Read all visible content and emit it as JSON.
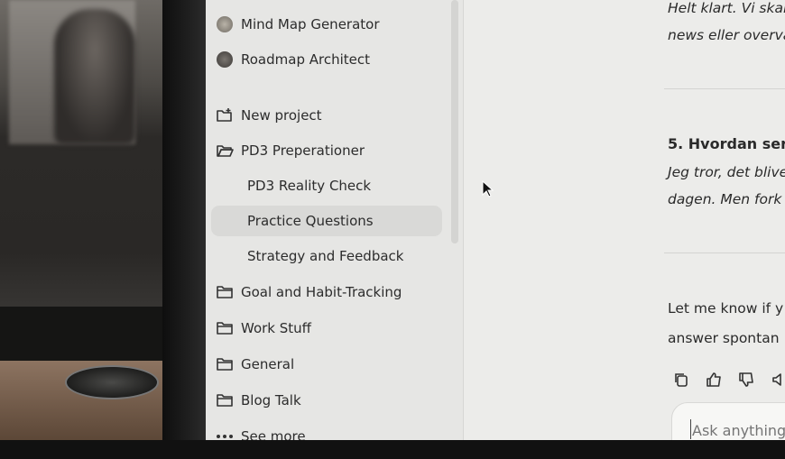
{
  "sidebar": {
    "gpts": [
      {
        "label": "Mind Map Generator",
        "icon": "mind-map-gpt-icon"
      },
      {
        "label": "Roadmap Architect",
        "icon": "roadmap-gpt-icon"
      }
    ],
    "new_project": {
      "label": "New project",
      "icon": "new-folder-icon"
    },
    "projects": [
      {
        "label": "PD3 Preperationer",
        "icon": "folder-open-icon"
      },
      {
        "label": "PD3 Reality Check",
        "icon": ""
      },
      {
        "label": "Practice Questions",
        "icon": ""
      },
      {
        "label": "Strategy and Feedback",
        "icon": ""
      },
      {
        "label": "Goal and Habit-Tracking",
        "icon": "folder-icon"
      },
      {
        "label": "Work Stuff",
        "icon": "folder-icon"
      },
      {
        "label": "General",
        "icon": "folder-icon"
      },
      {
        "label": "Blog Talk",
        "icon": "folder-icon"
      }
    ],
    "see_more": {
      "label": "See more",
      "icon": "more-dots-icon"
    }
  },
  "chat": {
    "top_lines": [
      "Helt klart. Vi skal",
      "news eller overva"
    ],
    "question_heading": "5. Hvordan ser",
    "answer_lines": [
      "Jeg tror, det blive",
      "dagen. Men fork"
    ],
    "closing_lines": [
      "Let me know if y",
      "answer spontan"
    ],
    "actions": [
      "copy-icon",
      "thumbs-up-icon",
      "thumbs-down-icon",
      "speaker-icon"
    ],
    "composer_placeholder": "Ask anything"
  },
  "colors": {
    "sidebar_bg": "#e6e6e4",
    "active_item_bg": "#d9d9d7",
    "chat_bg": "#ececea"
  }
}
